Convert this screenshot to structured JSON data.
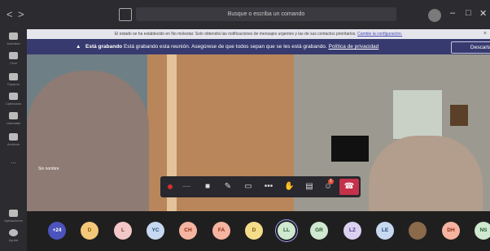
{
  "titlebar": {
    "back": "<",
    "forward": ">",
    "search_placeholder": "Busque o escriba un comando",
    "minimize": "–",
    "maximize": "□",
    "close": "✕"
  },
  "sidebar": {
    "items": [
      {
        "label": "Actividad"
      },
      {
        "label": "Chat"
      },
      {
        "label": "Equipos"
      },
      {
        "label": "Calendario"
      },
      {
        "label": "Llamadas"
      },
      {
        "label": "Archivos"
      },
      {
        "label": "..."
      },
      {
        "label": "Aplicaciones"
      },
      {
        "label": "Ayuda"
      }
    ]
  },
  "dnd_banner": {
    "text": "El estado se ha establecido en No molestar. Solo obtendrá las notificaciones de mensajes urgentes y las de sus contactos prioritarios.",
    "link": "Cambie la configuración.",
    "close": "×"
  },
  "recording_banner": {
    "bold": "Está grabando",
    "text": "Está grabando esta reunión. Asegúrese de que todos sepan que se les está grabando.",
    "link": "Política de privacidad",
    "dismiss": "Descartar"
  },
  "video": {
    "speaker_label": "Sin nombre"
  },
  "controls": {
    "more": "•••",
    "badge_count": "1"
  },
  "participants": [
    {
      "initials": "+24",
      "color": "#4b53bc",
      "text": "#ffffff"
    },
    {
      "initials": "D",
      "color": "#f4c87a",
      "text": "#8a5a00"
    },
    {
      "initials": "L",
      "color": "#f2c7c7",
      "text": "#7a3030"
    },
    {
      "initials": "YC",
      "color": "#c7d9f0",
      "text": "#2a4a7a"
    },
    {
      "initials": "CH",
      "color": "#f5b4a0",
      "text": "#8a2a10"
    },
    {
      "initials": "FA",
      "color": "#f5b4a0",
      "text": "#8a2a10"
    },
    {
      "initials": "D",
      "color": "#f4dc8a",
      "text": "#7a5a00"
    },
    {
      "initials": "LL",
      "color": "#cfe8d0",
      "text": "#2a5a30"
    },
    {
      "initials": "GR",
      "color": "#cfe8d0",
      "text": "#2a5a30"
    },
    {
      "initials": "LZ",
      "color": "#dcd0f0",
      "text": "#4a3080"
    },
    {
      "initials": "LE",
      "color": "#c7d9f0",
      "text": "#2a4a7a"
    },
    {
      "initials": "",
      "color": "#8a6a4a",
      "text": "#ffffff"
    },
    {
      "initials": "DH",
      "color": "#f5b4a0",
      "text": "#8a2a10"
    },
    {
      "initials": "NS",
      "color": "#cfe8d0",
      "text": "#2a5a30"
    }
  ]
}
